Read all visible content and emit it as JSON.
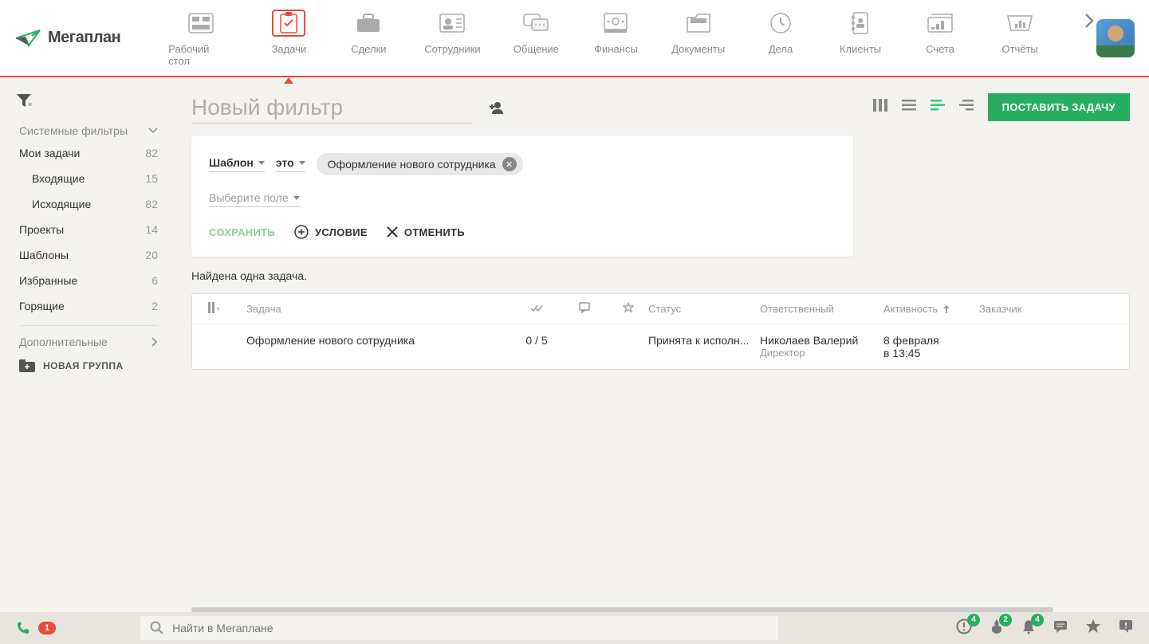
{
  "nav": {
    "items": [
      {
        "label": "Рабочий стол"
      },
      {
        "label": "Задачи"
      },
      {
        "label": "Сделки"
      },
      {
        "label": "Сотрудники"
      },
      {
        "label": "Общение"
      },
      {
        "label": "Финансы"
      },
      {
        "label": "Документы"
      },
      {
        "label": "Дела"
      },
      {
        "label": "Клиенты"
      },
      {
        "label": "Счета"
      },
      {
        "label": "Отчёты"
      }
    ]
  },
  "sidebar": {
    "system_filters": "Системные фильтры",
    "items": [
      {
        "label": "Мои задачи",
        "count": "82"
      },
      {
        "label": "Входящие",
        "count": "15",
        "sub": true
      },
      {
        "label": "Исходящие",
        "count": "82",
        "sub": true
      },
      {
        "label": "Проекты",
        "count": "14"
      },
      {
        "label": "Шаблоны",
        "count": "20"
      },
      {
        "label": "Избранные",
        "count": "6"
      },
      {
        "label": "Горящие",
        "count": "2"
      }
    ],
    "additional": "Дополнительные",
    "new_group": "НОВАЯ ГРУППА"
  },
  "filter": {
    "title": "Новый фильтр",
    "field": "Шаблон",
    "operator": "это",
    "chip": "Оформление нового сотрудника",
    "select_field": "Выберите поле",
    "save": "СОХРАНИТЬ",
    "condition": "УСЛОВИЕ",
    "cancel": "ОТМЕНИТЬ"
  },
  "create_button": "ПОСТАВИТЬ ЗАДАЧУ",
  "result": "Найдена одна задача.",
  "table": {
    "headers": {
      "task": "Задача",
      "status": "Статус",
      "responsible": "Ответственный",
      "activity": "Активность",
      "customer": "Заказчик"
    },
    "row": {
      "task": "Оформление нового сотрудника",
      "progress": "0 / 5",
      "status": "Принята к исполн...",
      "responsible": "Николаев Валерий",
      "responsible_role": "Директор",
      "activity_date": "8 февраля",
      "activity_time": "в 13:45"
    }
  },
  "footer": {
    "phone_badge": "1",
    "search_placeholder": "Найти в Мегаплане",
    "notif": {
      "alert": "4",
      "fire": "2",
      "bell": "4"
    }
  }
}
